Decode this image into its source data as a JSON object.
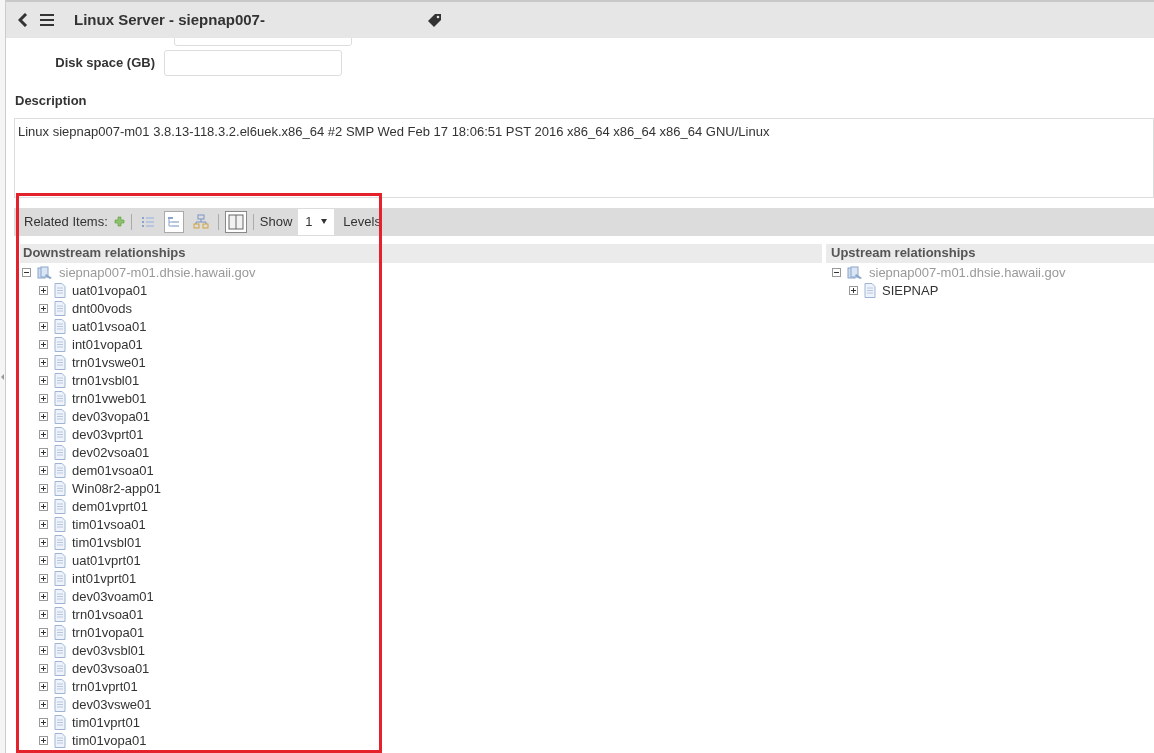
{
  "header": {
    "title": "Linux Server - siepnap007-"
  },
  "form": {
    "fields": [
      {
        "label": "Disk space (GB)"
      }
    ],
    "description": {
      "label": "Description",
      "value": "Linux siepnap007-m01 3.8.13-118.3.2.el6uek.x86_64 #2 SMP Wed Feb 17 18:06:51 PST 2016 x86_64 x86_64 x86_64 GNU/Linux"
    }
  },
  "toolbar": {
    "label": "Related Items:",
    "views": [
      {
        "kind": "list",
        "selected": false
      },
      {
        "kind": "tree",
        "selected": true
      },
      {
        "kind": "hierarchy",
        "selected": false
      }
    ],
    "split": {
      "selected": true
    },
    "show_label": "Show",
    "levels_value": "1",
    "levels_label": "Levels"
  },
  "downstream": {
    "title": "Downstream relationships",
    "tree": [
      {
        "label": "siepnap007-m01.dhsie.hawaii.gov",
        "kind": "server",
        "expanded": true,
        "children": [
          {
            "label": "uat01vopa01",
            "kind": "document",
            "expanded": false
          },
          {
            "label": "dnt00vods",
            "kind": "document",
            "expanded": false
          },
          {
            "label": "uat01vsoa01",
            "kind": "document",
            "expanded": false
          },
          {
            "label": "int01vopa01",
            "kind": "document",
            "expanded": false
          },
          {
            "label": "trn01vswe01",
            "kind": "document",
            "expanded": false
          },
          {
            "label": "trn01vsbl01",
            "kind": "document",
            "expanded": false
          },
          {
            "label": "trn01vweb01",
            "kind": "document",
            "expanded": false
          },
          {
            "label": "dev03vopa01",
            "kind": "document",
            "expanded": false
          },
          {
            "label": "dev03vprt01",
            "kind": "document",
            "expanded": false
          },
          {
            "label": "dev02vsoa01",
            "kind": "document",
            "expanded": false
          },
          {
            "label": "dem01vsoa01",
            "kind": "document",
            "expanded": false
          },
          {
            "label": "Win08r2-app01",
            "kind": "document",
            "expanded": false
          },
          {
            "label": "dem01vprt01",
            "kind": "document",
            "expanded": false
          },
          {
            "label": "tim01vsoa01",
            "kind": "document",
            "expanded": false
          },
          {
            "label": "tim01vsbl01",
            "kind": "document",
            "expanded": false
          },
          {
            "label": "uat01vprt01",
            "kind": "document",
            "expanded": false
          },
          {
            "label": "int01vprt01",
            "kind": "document",
            "expanded": false
          },
          {
            "label": "dev03voam01",
            "kind": "document",
            "expanded": false
          },
          {
            "label": "trn01vsoa01",
            "kind": "document",
            "expanded": false
          },
          {
            "label": "trn01vopa01",
            "kind": "document",
            "expanded": false
          },
          {
            "label": "dev03vsbl01",
            "kind": "document",
            "expanded": false
          },
          {
            "label": "dev03vsoa01",
            "kind": "document",
            "expanded": false
          },
          {
            "label": "trn01vprt01",
            "kind": "document",
            "expanded": false
          },
          {
            "label": "dev03vswe01",
            "kind": "document",
            "expanded": false
          },
          {
            "label": "tim01vprt01",
            "kind": "document",
            "expanded": false
          },
          {
            "label": "tim01vopa01",
            "kind": "document",
            "expanded": false
          }
        ]
      }
    ]
  },
  "upstream": {
    "title": "Upstream relationships",
    "tree": [
      {
        "label": "siepnap007-m01.dhsie.hawaii.gov",
        "kind": "server",
        "expanded": true,
        "children": [
          {
            "label": "SIEPNAP",
            "kind": "document",
            "expanded": false
          }
        ]
      }
    ]
  }
}
